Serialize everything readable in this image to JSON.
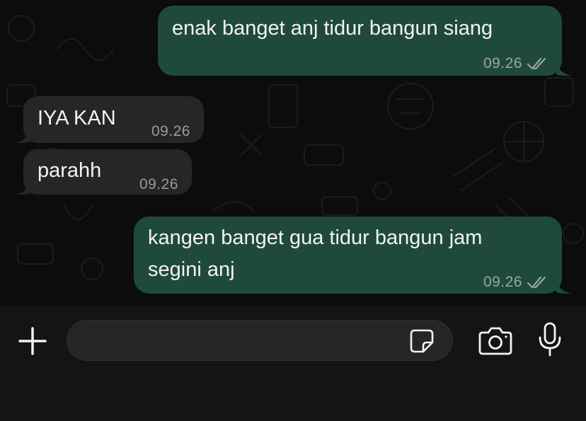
{
  "messages": [
    {
      "direction": "outgoing",
      "lines": [
        "enak banget anj tidur bangun siang"
      ],
      "time": "09.26",
      "status": "read"
    },
    {
      "direction": "incoming",
      "lines": [
        "IYA KAN"
      ],
      "time": "09.26"
    },
    {
      "direction": "incoming",
      "lines": [
        "parahh"
      ],
      "time": "09.26"
    },
    {
      "direction": "outgoing",
      "lines": [
        "kangen banget gua tidur bangun jam",
        "segini anj"
      ],
      "time": "09.26",
      "status": "read"
    }
  ],
  "composer": {
    "placeholder": "",
    "icons": [
      "plus-icon",
      "sticker-icon",
      "camera-icon",
      "microphone-icon"
    ]
  },
  "colors": {
    "outgoing_bubble": "#1f4a3a",
    "incoming_bubble": "#262626",
    "background": "#0c0c0c",
    "read_ticks": "#9aa7a1"
  }
}
